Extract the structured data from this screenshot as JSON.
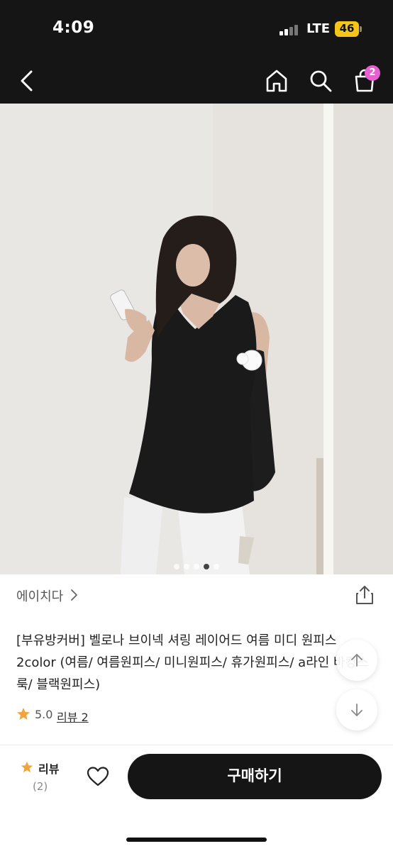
{
  "status_bar": {
    "time": "4:09",
    "network": "LTE",
    "battery": "46",
    "battery_color": "#f5c518"
  },
  "nav": {
    "back_icon": "chevron-left-icon",
    "home_icon": "home-icon",
    "search_icon": "search-icon",
    "cart_icon": "shopping-bag-icon",
    "cart_badge": "2",
    "badge_color": "#e85fd0"
  },
  "gallery": {
    "image_count": 5,
    "active_index": 3
  },
  "product": {
    "brand": "에이치다",
    "title": "[부유방커버] 벨로나 브이넥 셔링 레이어드 여름 미디 원피스 2color (여름/ 여름원피스/ 미니원피스/ 휴가원피스/ a라인 바캉스룩/ 블랙원피스)",
    "rating": "5.0",
    "review_link": "리뷰 2",
    "star_color": "#f2a33a"
  },
  "bottom_bar": {
    "review_label": "리뷰",
    "review_count": "(2)",
    "buy_label": "구매하기",
    "buy_color": "#151515"
  }
}
